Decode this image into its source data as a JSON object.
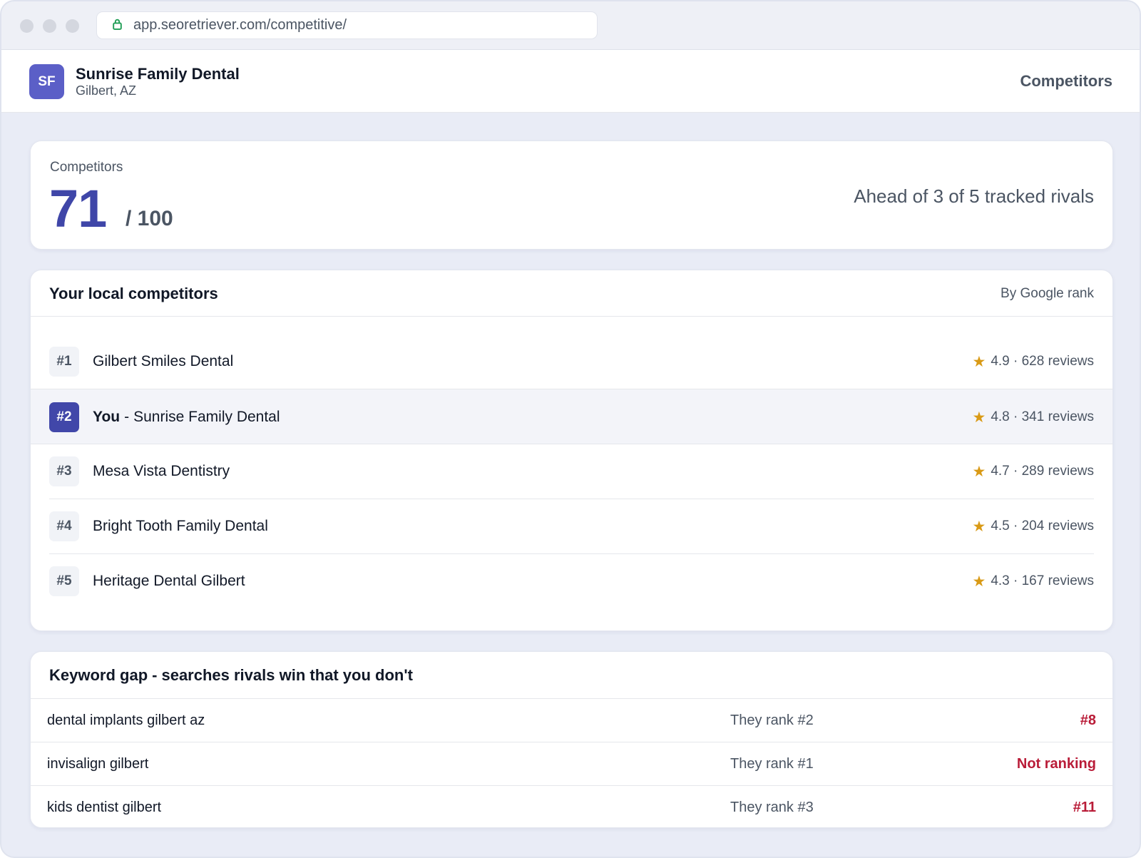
{
  "browser": {
    "url": "app.seoretriever.com/competitive/",
    "lock_icon": "lock-icon"
  },
  "header": {
    "avatar_initials": "SF",
    "business_name": "Sunrise Family Dental",
    "location": "Gilbert, AZ",
    "nav_label": "Competitors"
  },
  "score": {
    "label": "Competitors",
    "value": "71",
    "max": "/ 100",
    "summary": "Ahead of 3 of 5 tracked rivals"
  },
  "competitors": {
    "title": "Your local competitors",
    "sort_label": "By Google rank",
    "you_tag": "You",
    "separator": "-",
    "rows": [
      {
        "rank": "#1",
        "name": "Gilbert Smiles Dental",
        "rating": "4.9 · 628 reviews",
        "is_you": false
      },
      {
        "rank": "#2",
        "name": "Sunrise Family Dental",
        "rating": "4.8 · 341 reviews",
        "is_you": true
      },
      {
        "rank": "#3",
        "name": "Mesa Vista Dentistry",
        "rating": "4.7 · 289 reviews",
        "is_you": false
      },
      {
        "rank": "#4",
        "name": "Bright Tooth Family Dental",
        "rating": "4.5 · 204 reviews",
        "is_you": false
      },
      {
        "rank": "#5",
        "name": "Heritage Dental Gilbert",
        "rating": "4.3 · 167 reviews",
        "is_you": false
      }
    ]
  },
  "keyword_gap": {
    "title": "Keyword gap",
    "separator": "-",
    "subtitle": "searches rivals win that you don't",
    "rows": [
      {
        "keyword": "dental implants gilbert az",
        "they_rank": "They rank #2",
        "your_rank": "#8"
      },
      {
        "keyword": "invisalign gilbert",
        "they_rank": "They rank #1",
        "your_rank": "Not ranking"
      },
      {
        "keyword": "kids dentist gilbert",
        "they_rank": "They rank #3",
        "your_rank": "#11"
      }
    ]
  },
  "colors": {
    "accent": "#3f46a8",
    "avatar": "#5b5fc7",
    "star": "#d99a16",
    "negative": "#b91c38",
    "background": "#e9ecf6"
  }
}
